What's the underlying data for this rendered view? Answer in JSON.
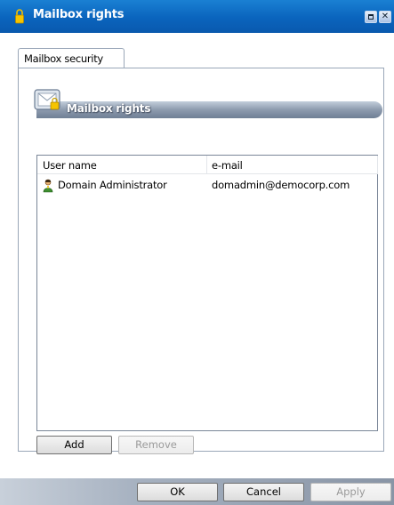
{
  "window": {
    "title": "Mailbox rights",
    "title_icon": "lock-icon",
    "minimize_icon": "minimize-icon",
    "close_icon": "close-icon"
  },
  "tabs": [
    {
      "label": "Mailbox security",
      "selected": true
    }
  ],
  "section": {
    "title": "Mailbox rights",
    "icon": "mail-envelope-icon"
  },
  "listview": {
    "columns": [
      "User name",
      "e-mail"
    ],
    "rows": [
      {
        "user": "Domain Administrator",
        "email": "domadmin@democorp.com",
        "icon": "user-icon"
      }
    ]
  },
  "buttons": {
    "add": "Add",
    "remove": "Remove",
    "ok": "OK",
    "cancel": "Cancel",
    "apply": "Apply"
  },
  "colors": {
    "titlebar": "#0a64bd",
    "section_bar": "#8d9bae",
    "footer": "#a6b1c0"
  }
}
